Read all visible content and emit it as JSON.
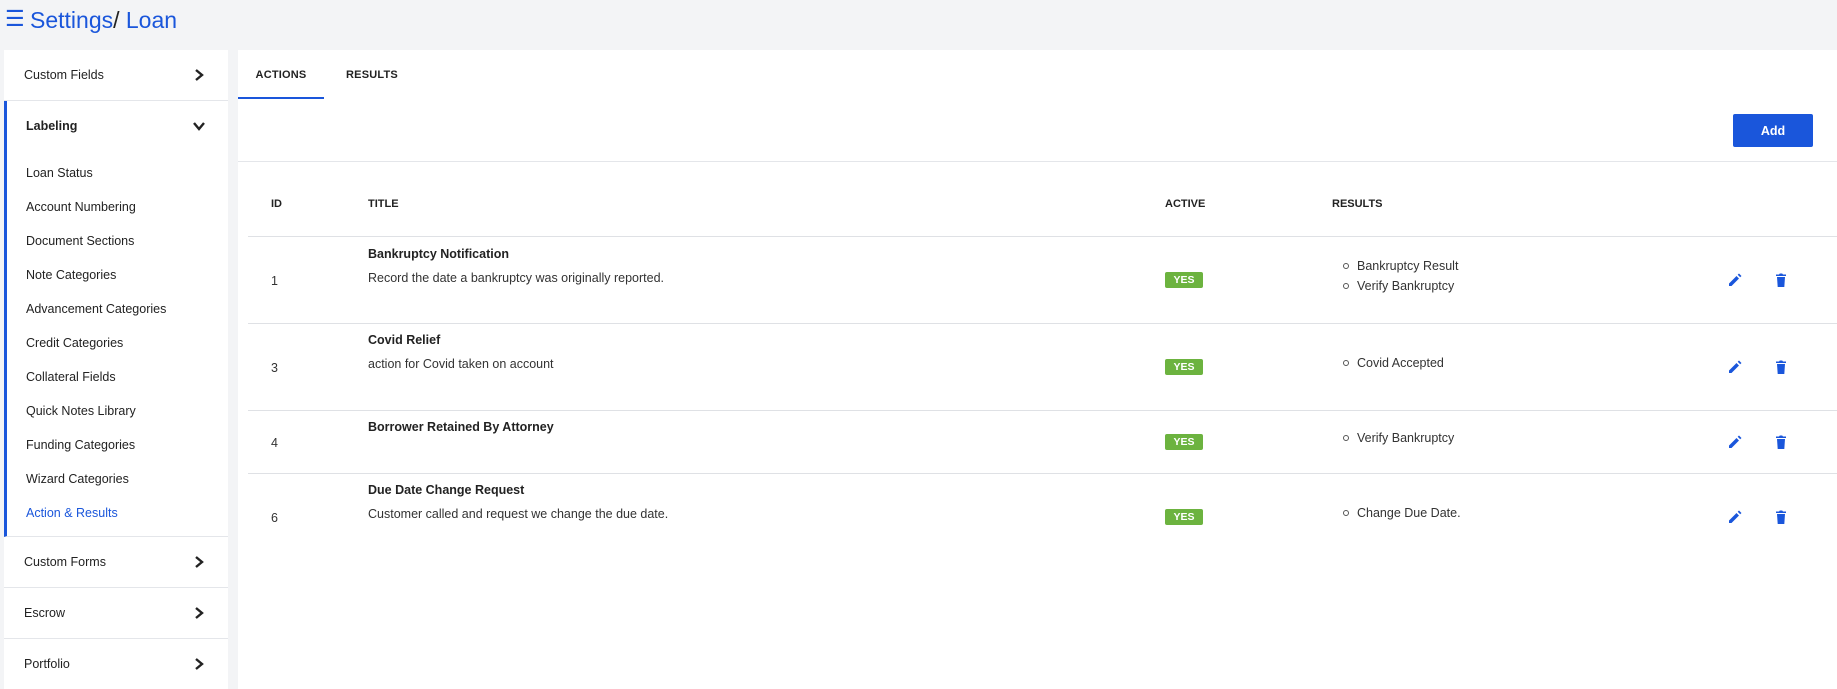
{
  "header": {
    "menu_icon": "hamburger-icon",
    "breadcrumb": {
      "root": "Settings",
      "separator": "/",
      "current": " Loan"
    }
  },
  "sidebar": {
    "sections_top": [
      {
        "label": "Custom Fields",
        "icon": "chevron-right-icon"
      }
    ],
    "expanded": {
      "label": "Labeling",
      "icon": "chevron-down-icon",
      "items": [
        "Loan Status",
        "Account Numbering",
        "Document Sections",
        "Note Categories",
        "Advancement Categories",
        "Credit Categories",
        "Collateral Fields",
        "Quick Notes Library",
        "Funding Categories",
        "Wizard Categories",
        "Action & Results"
      ],
      "active_item": "Action & Results"
    },
    "sections_bottom": [
      {
        "label": "Custom Forms",
        "icon": "chevron-right-icon"
      },
      {
        "label": "Escrow",
        "icon": "chevron-right-icon"
      },
      {
        "label": "Portfolio",
        "icon": "chevron-right-icon"
      }
    ]
  },
  "main": {
    "tabs": [
      {
        "label": "ACTIONS",
        "active": true
      },
      {
        "label": "RESULTS",
        "active": false
      }
    ],
    "add_label": "Add",
    "columns": [
      "ID",
      "TITLE",
      "ACTIVE",
      "RESULTS"
    ],
    "rows": [
      {
        "id": "1",
        "title": "Bankruptcy Notification",
        "description": "Record the date a bankruptcy was originally reported.",
        "active": "YES",
        "results": [
          "Bankruptcy Result",
          "Verify Bankruptcy"
        ]
      },
      {
        "id": "3",
        "title": "Covid Relief",
        "description": "action for Covid taken on account",
        "active": "YES",
        "results": [
          "Covid Accepted"
        ]
      },
      {
        "id": "4",
        "title": "Borrower Retained By Attorney",
        "description": "",
        "active": "YES",
        "results": [
          "Verify Bankruptcy"
        ]
      },
      {
        "id": "6",
        "title": "Due Date Change Request",
        "description": "Customer called and request we change the due date.",
        "active": "YES",
        "results": [
          "Change Due Date."
        ]
      }
    ],
    "row_actions": {
      "edit_icon": "pencil-icon",
      "delete_icon": "trash-icon"
    }
  },
  "colors": {
    "accent": "#1a56db",
    "active_badge": "#6cb33f",
    "page_bg": "#f3f4f6"
  }
}
